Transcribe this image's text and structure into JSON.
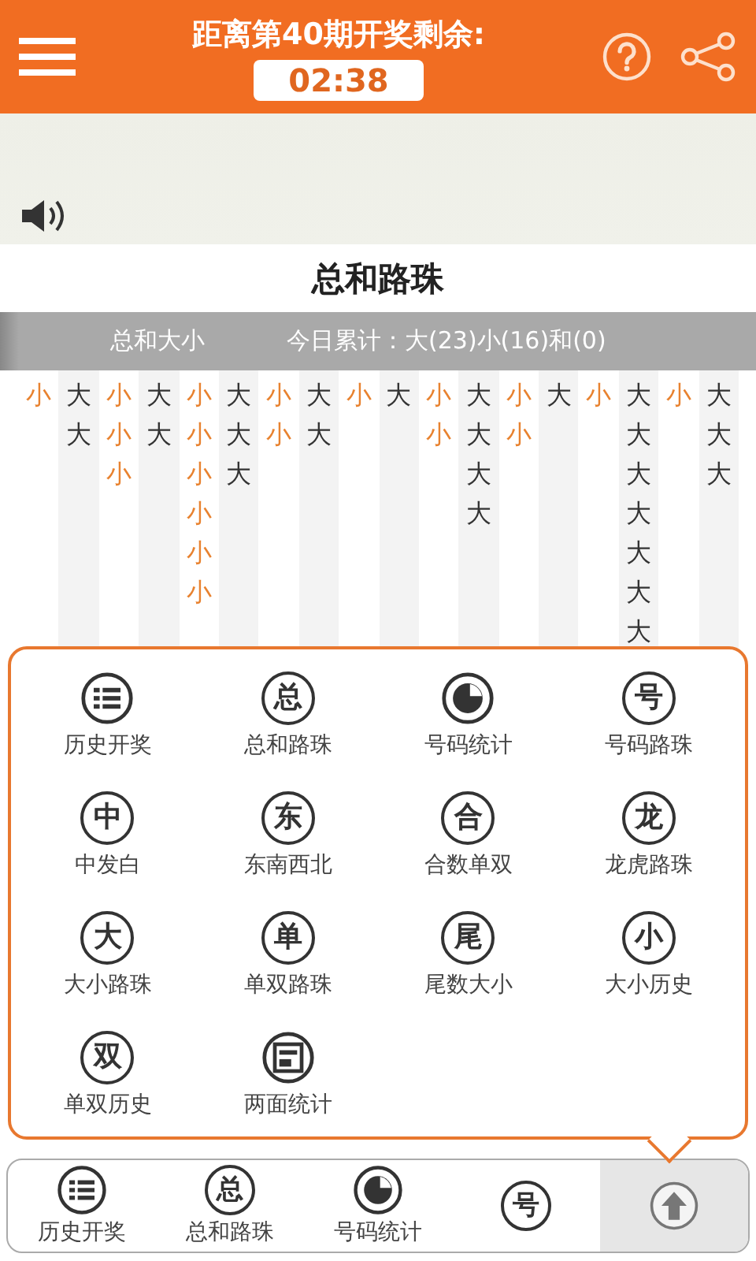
{
  "header": {
    "title": "距离第40期开奖剩余:",
    "countdown": "02:38"
  },
  "page_title": "总和路珠",
  "summary_bar": {
    "label": "总和大小",
    "totals": "今日累计：大(23)小(16)和(0)"
  },
  "road_columns": [
    {
      "color": "#e8822f",
      "cells": [
        "小"
      ]
    },
    {
      "color": "#333333",
      "cells": [
        "大",
        "大"
      ]
    },
    {
      "color": "#e8822f",
      "cells": [
        "小",
        "小",
        "小"
      ]
    },
    {
      "color": "#333333",
      "cells": [
        "大",
        "大"
      ]
    },
    {
      "color": "#e8822f",
      "cells": [
        "小",
        "小",
        "小",
        "小",
        "小",
        "小"
      ]
    },
    {
      "color": "#333333",
      "cells": [
        "大",
        "大",
        "大"
      ]
    },
    {
      "color": "#e8822f",
      "cells": [
        "小",
        "小"
      ]
    },
    {
      "color": "#333333",
      "cells": [
        "大",
        "大"
      ]
    },
    {
      "color": "#e8822f",
      "cells": [
        "小"
      ]
    },
    {
      "color": "#333333",
      "cells": [
        "大"
      ]
    },
    {
      "color": "#e8822f",
      "cells": [
        "小",
        "小"
      ]
    },
    {
      "color": "#333333",
      "cells": [
        "大",
        "大",
        "大",
        "大"
      ]
    },
    {
      "color": "#e8822f",
      "cells": [
        "小",
        "小"
      ]
    },
    {
      "color": "#333333",
      "cells": [
        "大"
      ]
    },
    {
      "color": "#e8822f",
      "cells": [
        "小"
      ]
    },
    {
      "color": "#333333",
      "cells": [
        "大",
        "大",
        "大",
        "大",
        "大",
        "大",
        "大"
      ]
    },
    {
      "color": "#e8822f",
      "cells": [
        "小"
      ]
    },
    {
      "color": "#333333",
      "cells": [
        "大",
        "大",
        "大"
      ]
    }
  ],
  "menu_popup": {
    "items": [
      {
        "kind": "list",
        "label": "历史开奖"
      },
      {
        "kind": "glyph",
        "glyph": "总",
        "label": "总和路珠"
      },
      {
        "kind": "pie",
        "label": "号码统计"
      },
      {
        "kind": "glyph",
        "glyph": "号",
        "label": "号码路珠"
      },
      {
        "kind": "glyph",
        "glyph": "中",
        "label": "中发白"
      },
      {
        "kind": "glyph",
        "glyph": "东",
        "label": "东南西北"
      },
      {
        "kind": "glyph",
        "glyph": "合",
        "label": "合数单双"
      },
      {
        "kind": "glyph",
        "glyph": "龙",
        "label": "龙虎路珠"
      },
      {
        "kind": "glyph",
        "glyph": "大",
        "label": "大小路珠"
      },
      {
        "kind": "glyph",
        "glyph": "单",
        "label": "单双路珠"
      },
      {
        "kind": "glyph",
        "glyph": "尾",
        "label": "尾数大小"
      },
      {
        "kind": "glyph",
        "glyph": "小",
        "label": "大小历史"
      },
      {
        "kind": "glyph",
        "glyph": "双",
        "label": "单双历史"
      },
      {
        "kind": "doc",
        "label": "两面统计"
      }
    ]
  },
  "bottom_nav": [
    {
      "kind": "list",
      "label": "历史开奖",
      "selected": false
    },
    {
      "kind": "glyph",
      "glyph": "总",
      "label": "总和路珠",
      "selected": false
    },
    {
      "kind": "pie",
      "label": "号码统计",
      "selected": false
    },
    {
      "kind": "glyph",
      "glyph": "号",
      "selected": false
    },
    {
      "kind": "up",
      "selected": true
    }
  ]
}
